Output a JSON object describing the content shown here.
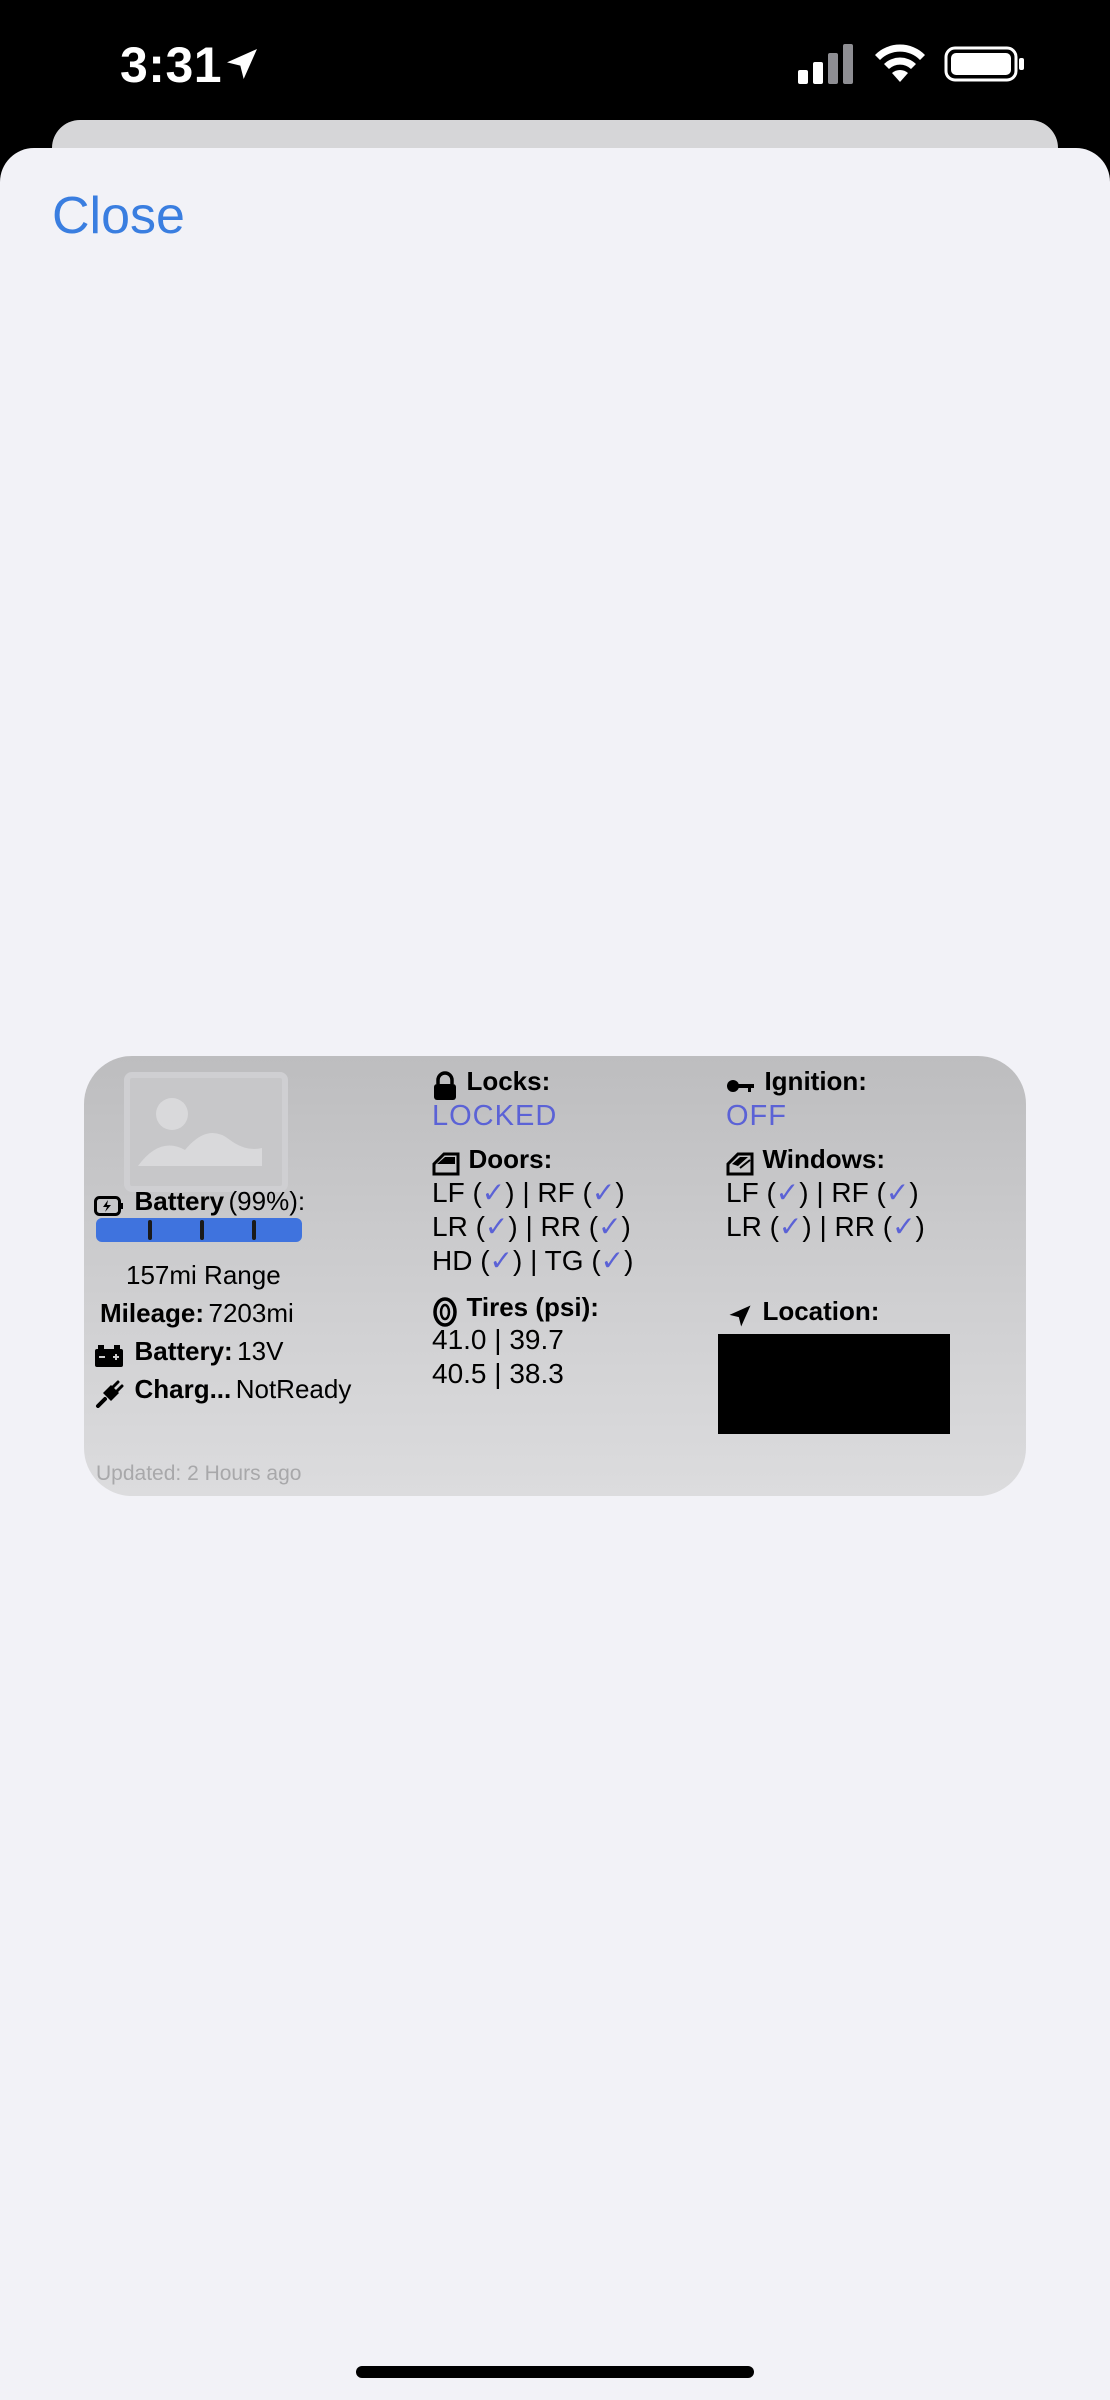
{
  "status_bar": {
    "time": "3:31"
  },
  "sheet": {
    "close_label": "Close"
  },
  "widget": {
    "battery": {
      "label": "Battery",
      "percent_text": "(99%):",
      "level": 0.99,
      "range": "157mi Range"
    },
    "mileage": {
      "label": "Mileage:",
      "value": "7203mi"
    },
    "battery12v": {
      "label": "Battery:",
      "value": "13V"
    },
    "charge": {
      "label": "Charg...",
      "value": "NotReady"
    },
    "locks": {
      "label": "Locks:",
      "value": "LOCKED"
    },
    "doors": {
      "label": "Doors:",
      "rows": [
        {
          "a": "LF (",
          "b": ")  | RF (",
          "c": ")"
        },
        {
          "a": "LR (",
          "b": ")  | RR (",
          "c": ")"
        },
        {
          "a": "HD (",
          "b": ") | TG (",
          "c": ")"
        }
      ]
    },
    "tires": {
      "label": "Tires (psi):",
      "row1": "41.0  | 39.7",
      "row2": "40.5 | 38.3"
    },
    "ignition": {
      "label": "Ignition:",
      "value": "OFF"
    },
    "windows": {
      "label": "Windows:",
      "rows": [
        {
          "a": "LF (",
          "b": ") | RF (",
          "c": ")"
        },
        {
          "a": "LR (",
          "b": ") | RR (",
          "c": ")"
        }
      ]
    },
    "location": {
      "label": "Location:"
    },
    "updated": "Updated: 2 Hours ago",
    "check_glyph": "✓"
  },
  "colors": {
    "accent": "#3a7ee0",
    "status_value": "#5b62d6",
    "battery_bar": "#3f73de"
  }
}
